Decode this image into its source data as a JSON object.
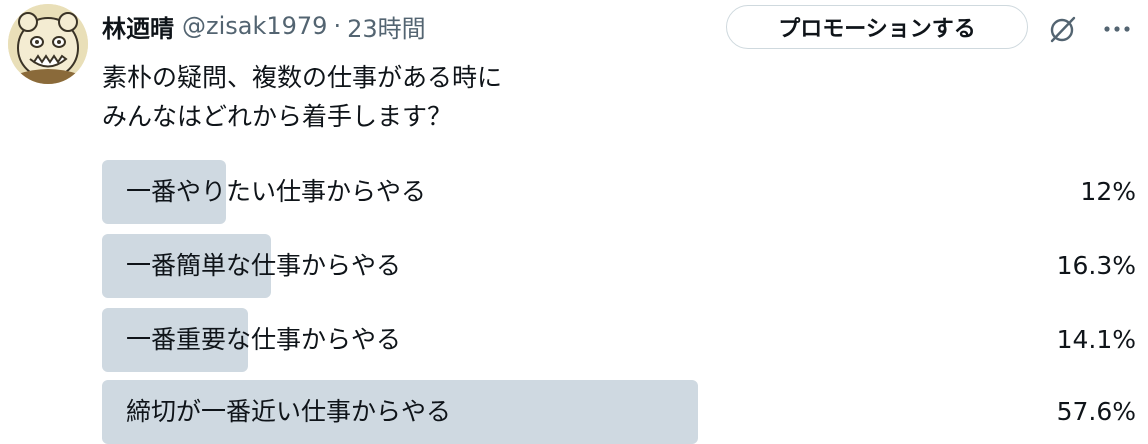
{
  "tweet": {
    "author_name": "林迺晴",
    "handle": "@zisak1979",
    "separator": "·",
    "time": "23時間",
    "promote_label": "プロモーションする",
    "text_lines": [
      "素朴の疑問、複数の仕事がある時に",
      "みんなはどれから着手します？"
    ]
  },
  "icons": {
    "avatar": "avatar-illustration",
    "grok": "grok-icon",
    "more": "more-icon"
  },
  "colors": {
    "bar": "#cfd9e1",
    "text": "#0f1419",
    "secondary": "#536471"
  },
  "poll": {
    "options": [
      {
        "label": "一番やりたい仕事からやる",
        "percent_text": "12%",
        "fraction": 0.12
      },
      {
        "label": "一番簡単な仕事からやる",
        "percent_text": "16.3%",
        "fraction": 0.163
      },
      {
        "label": "一番重要な仕事からやる",
        "percent_text": "14.1%",
        "fraction": 0.141
      },
      {
        "label": "締切が一番近い仕事からやる",
        "percent_text": "57.6%",
        "fraction": 0.576
      }
    ]
  }
}
